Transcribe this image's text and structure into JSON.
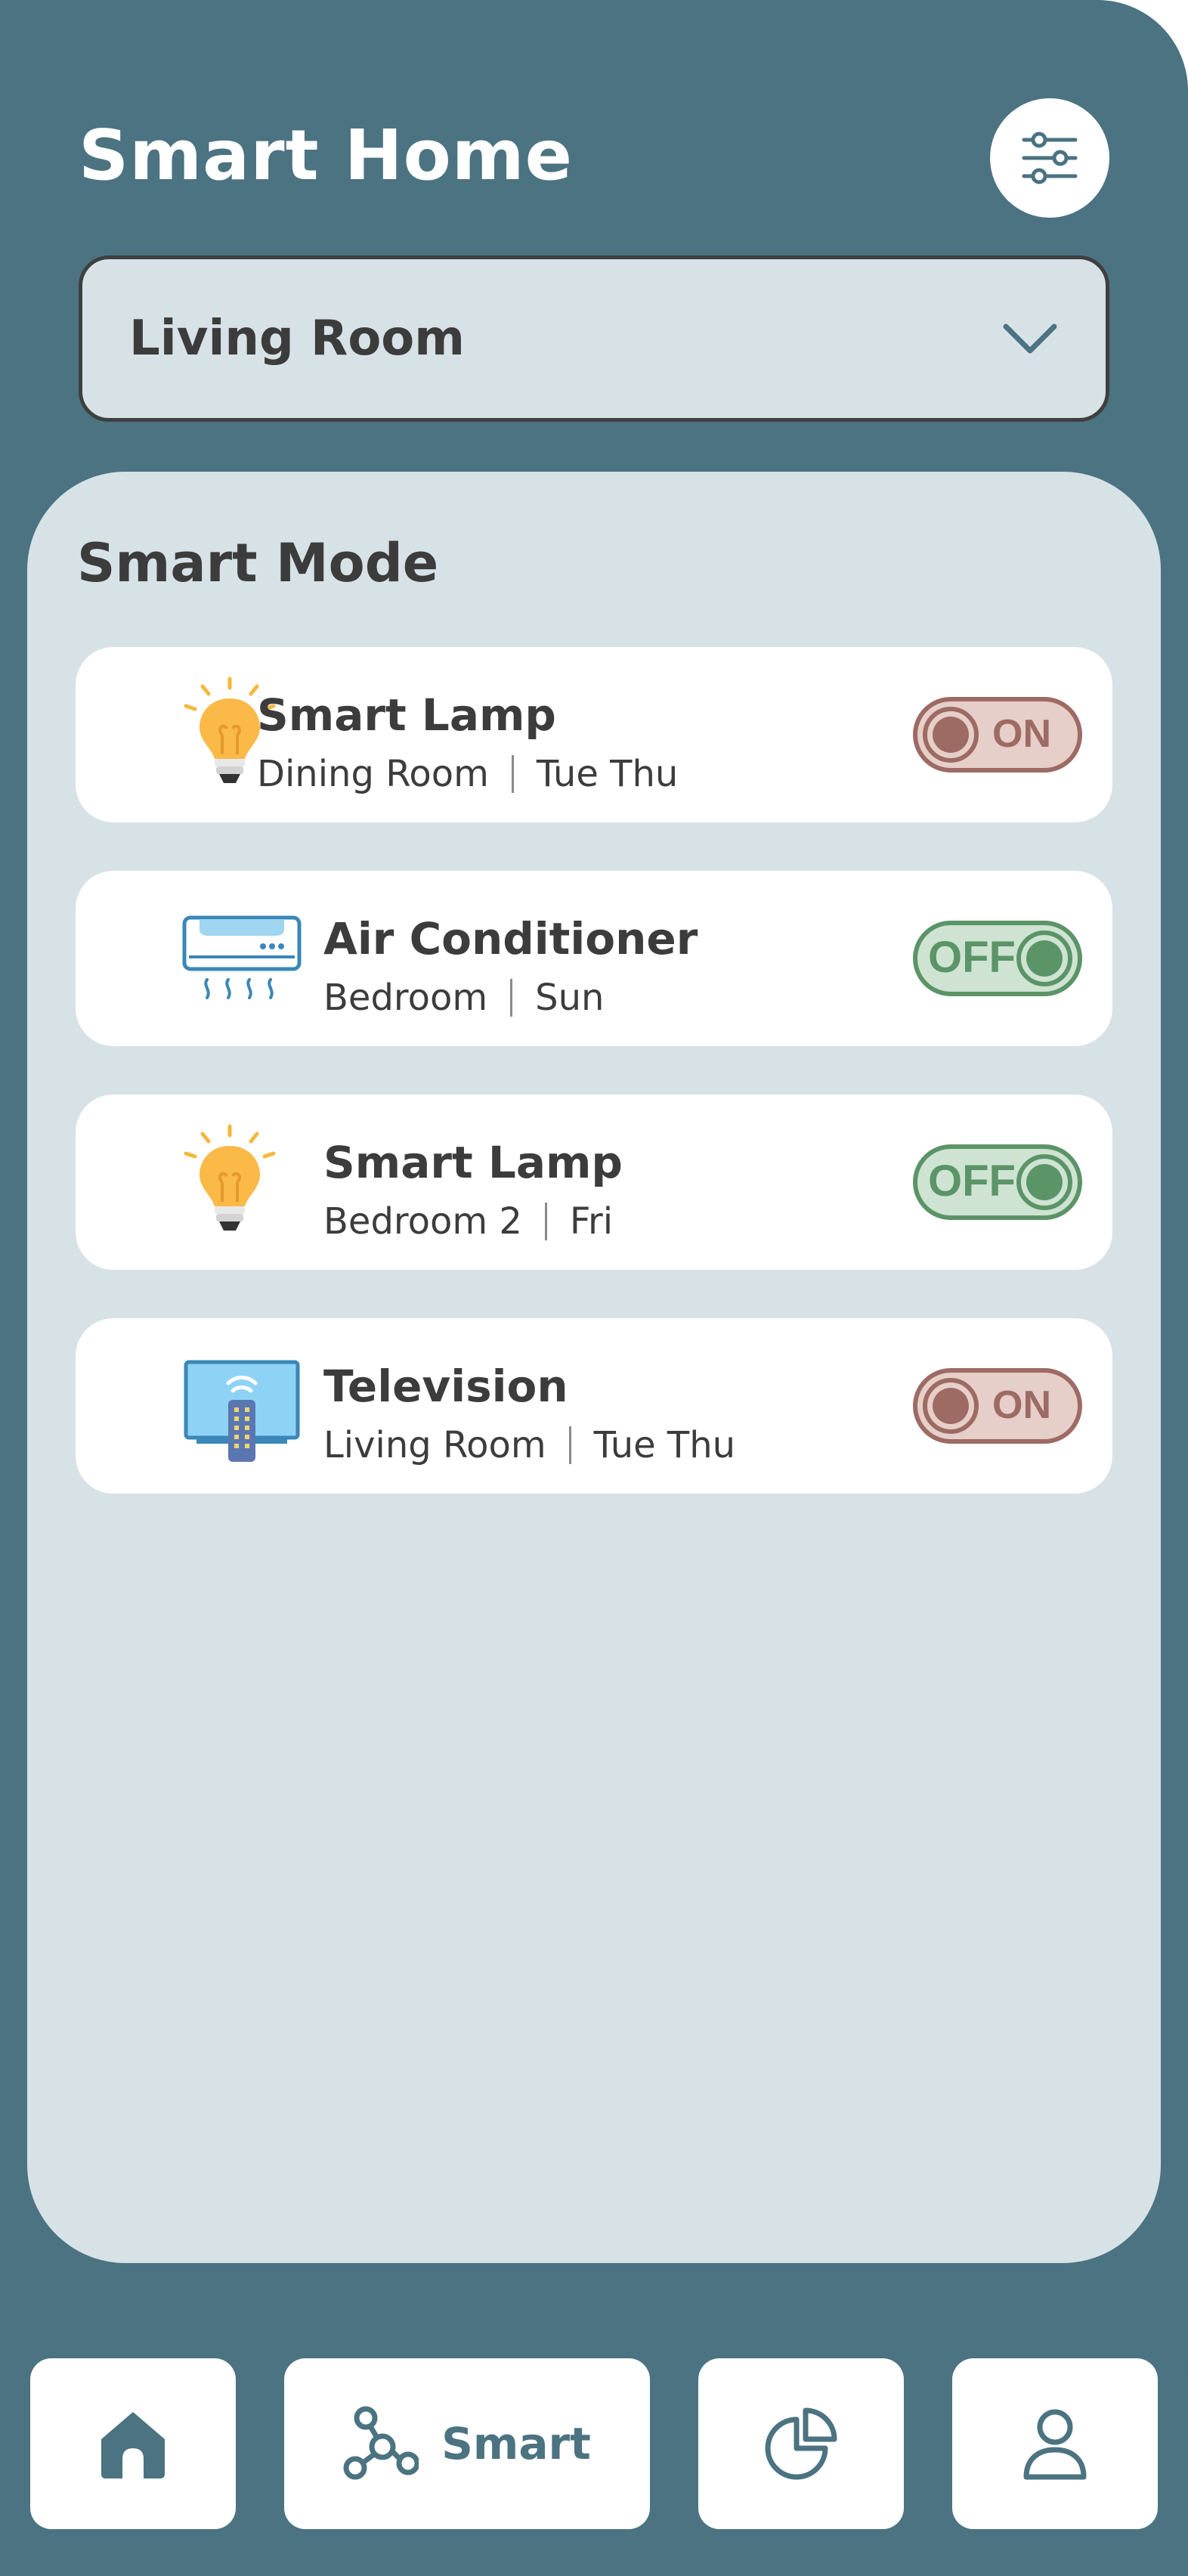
{
  "header": {
    "title": "Smart Home",
    "filter_icon": "sliders-icon"
  },
  "room_selector": {
    "selected": "Living Room",
    "icon": "chevron-down-icon"
  },
  "smart_mode": {
    "title": "Smart Mode",
    "devices": [
      {
        "name": "Smart Lamp",
        "room": "Dining Room",
        "days": "Tue Thu",
        "icon": "lamp-icon",
        "state": "ON"
      },
      {
        "name": "Air Conditioner",
        "room": "Bedroom",
        "days": "Sun",
        "icon": "air-conditioner-icon",
        "state": "OFF"
      },
      {
        "name": "Smart Lamp",
        "room": "Bedroom 2",
        "days": "Fri",
        "icon": "lamp-icon",
        "state": "OFF"
      },
      {
        "name": "Television",
        "room": "Living Room",
        "days": "Tue Thu",
        "icon": "television-icon",
        "state": "ON"
      }
    ]
  },
  "nav": {
    "items": [
      {
        "icon": "home-icon",
        "label": ""
      },
      {
        "icon": "nodes-icon",
        "label": "Smart"
      },
      {
        "icon": "pie-chart-icon",
        "label": ""
      },
      {
        "icon": "user-icon",
        "label": ""
      }
    ]
  },
  "colors": {
    "background": "#4b7381",
    "panel": "#d7e2e7",
    "on_toggle": "#9d6b64",
    "off_toggle": "#5b9467",
    "text_dark": "#3c3c3c"
  }
}
